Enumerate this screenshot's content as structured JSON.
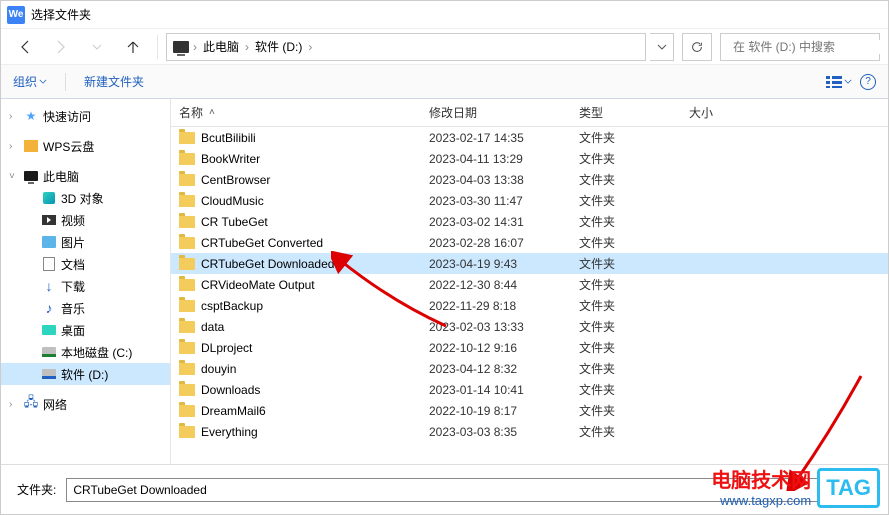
{
  "titlebar": {
    "app_icon_text": "We",
    "title": "选择文件夹"
  },
  "breadcrumb": {
    "crumbs": [
      "此电脑",
      "软件 (D:)"
    ],
    "sep": "›"
  },
  "search": {
    "placeholder": "在 软件 (D:) 中搜索"
  },
  "toolbar": {
    "organize": "组织",
    "new_folder": "新建文件夹"
  },
  "sidebar": {
    "items": [
      {
        "label": "快速访问",
        "icon": "star",
        "indent": 0,
        "expandable": true
      },
      {
        "label": "WPS云盘",
        "icon": "wps",
        "indent": 0,
        "expandable": true
      },
      {
        "label": "此电脑",
        "icon": "pc",
        "indent": 0,
        "expandable": true,
        "expanded": true
      },
      {
        "label": "3D 对象",
        "icon": "3d",
        "indent": 1
      },
      {
        "label": "视频",
        "icon": "video",
        "indent": 1
      },
      {
        "label": "图片",
        "icon": "image",
        "indent": 1
      },
      {
        "label": "文档",
        "icon": "doc",
        "indent": 1
      },
      {
        "label": "下载",
        "icon": "download",
        "indent": 1
      },
      {
        "label": "音乐",
        "icon": "music",
        "indent": 1
      },
      {
        "label": "桌面",
        "icon": "desktop",
        "indent": 1
      },
      {
        "label": "本地磁盘 (C:)",
        "icon": "disk-c",
        "indent": 1
      },
      {
        "label": "软件 (D:)",
        "icon": "disk-d",
        "indent": 1,
        "selected": true
      },
      {
        "label": "网络",
        "icon": "network",
        "indent": 0,
        "expandable": true
      }
    ]
  },
  "columns": {
    "name": "名称",
    "date": "修改日期",
    "type": "类型",
    "size": "大小"
  },
  "files": [
    {
      "name": "BcutBilibili",
      "date": "2023-02-17 14:35",
      "type": "文件夹"
    },
    {
      "name": "BookWriter",
      "date": "2023-04-11 13:29",
      "type": "文件夹"
    },
    {
      "name": "CentBrowser",
      "date": "2023-04-03 13:38",
      "type": "文件夹"
    },
    {
      "name": "CloudMusic",
      "date": "2023-03-30 11:47",
      "type": "文件夹"
    },
    {
      "name": "CR TubeGet",
      "date": "2023-03-02 14:31",
      "type": "文件夹"
    },
    {
      "name": "CRTubeGet Converted",
      "date": "2023-02-28 16:07",
      "type": "文件夹"
    },
    {
      "name": "CRTubeGet Downloaded",
      "date": "2023-04-19 9:43",
      "type": "文件夹",
      "selected": true
    },
    {
      "name": "CRVideoMate Output",
      "date": "2022-12-30 8:44",
      "type": "文件夹"
    },
    {
      "name": "csptBackup",
      "date": "2022-11-29 8:18",
      "type": "文件夹"
    },
    {
      "name": "data",
      "date": "2023-02-03 13:33",
      "type": "文件夹"
    },
    {
      "name": "DLproject",
      "date": "2022-10-12 9:16",
      "type": "文件夹"
    },
    {
      "name": "douyin",
      "date": "2023-04-12 8:32",
      "type": "文件夹"
    },
    {
      "name": "Downloads",
      "date": "2023-01-14 10:41",
      "type": "文件夹"
    },
    {
      "name": "DreamMail6",
      "date": "2022-10-19 8:17",
      "type": "文件夹"
    },
    {
      "name": "Everything",
      "date": "2023-03-03 8:35",
      "type": "文件夹"
    }
  ],
  "footer": {
    "label": "文件夹:",
    "value": "CRTubeGet Downloaded"
  },
  "watermark": {
    "line1": "电脑技术网",
    "line2": "www.tagxp.com",
    "tag": "TAG"
  }
}
